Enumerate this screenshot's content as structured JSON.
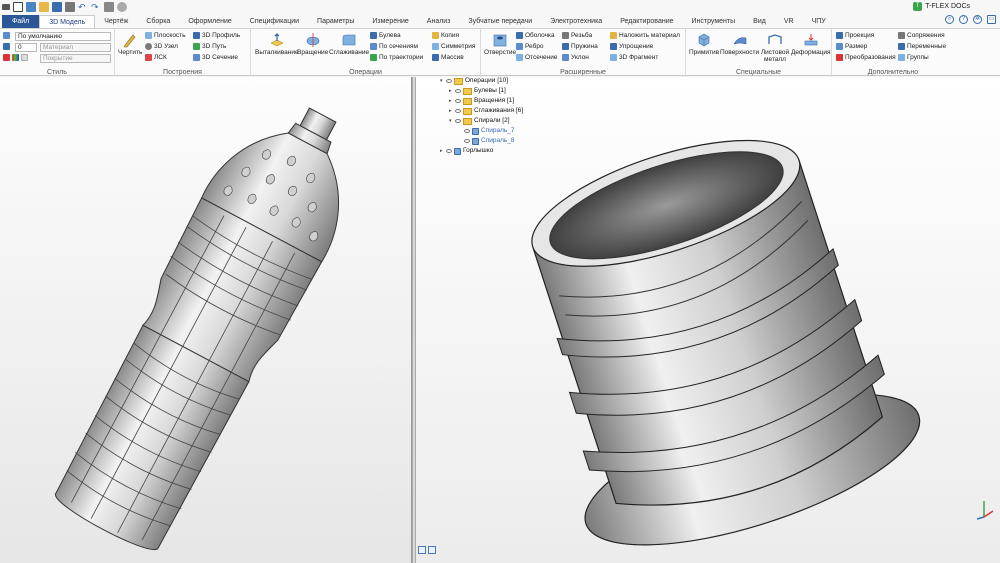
{
  "app": {
    "name": "T-FLEX DOCs"
  },
  "menu": {
    "tabs": [
      "Файл",
      "3D Модель",
      "Чертёж",
      "Сборка",
      "Оформление",
      "Спецификации",
      "Параметры",
      "Измерение",
      "Анализ",
      "Зубчатые передачи",
      "Электротехника",
      "Редактирование",
      "Инструменты",
      "Вид",
      "VR",
      "ЧПУ"
    ],
    "active_index": 1
  },
  "ribbon": {
    "style": {
      "title": "Стиль",
      "preset_value": "По умолчанию",
      "layer_value": "0",
      "material_placeholder": "Материал",
      "coating_placeholder": "Покрытие"
    },
    "build": {
      "title": "Построения",
      "draw_label": "Чертить",
      "plane_label": "Плоскость",
      "node3d_label": "3D Узел",
      "lsk_label": "ЛСК",
      "profile_label": "3D Профиль",
      "path_label": "3D Путь",
      "section_label": "3D Сечение"
    },
    "operations": {
      "title": "Операции",
      "extrude_label": "Выталкивание",
      "revolve_label": "Вращение",
      "smooth_label": "Сглаживание",
      "boolean_label": "Булева",
      "sections_label": "По сечениям",
      "trajectory_label": "По траектории",
      "copy_label": "Копия",
      "symmetry_label": "Симметрия",
      "array_label": "Массив"
    },
    "advanced": {
      "title": "Расширенные",
      "hole_label": "Отверстие",
      "shell_label": "Оболочка",
      "rib_label": "Ребро",
      "cut_label": "Отсечение",
      "thread_label": "Резьба",
      "spring_label": "Пружина",
      "slope_label": "Уклон",
      "apply_material_label": "Наложить материал",
      "simplify_label": "Упрощение",
      "fragment_label": "3D Фрагмент"
    },
    "special": {
      "title": "Специальные",
      "primitives_label": "Примитив",
      "surfaces_label": "Поверхности",
      "sheet_label": "Листовой металл",
      "deform_label": "Деформация"
    },
    "extra": {
      "title": "Дополнительно",
      "projection_label": "Проекция",
      "size_label": "Размер",
      "transform_label": "Преобразования",
      "mates_label": "Сопряжения",
      "variables_label": "Переменные",
      "groups_label": "Группы"
    }
  },
  "tree": {
    "items": [
      {
        "label": "Операции [10]",
        "level": 0,
        "kind": "folder",
        "expanded": true
      },
      {
        "label": "Булевы [1]",
        "level": 1,
        "kind": "folder",
        "expanded": false
      },
      {
        "label": "Вращения [1]",
        "level": 1,
        "kind": "folder",
        "expanded": false
      },
      {
        "label": "Сглаживания [6]",
        "level": 1,
        "kind": "folder",
        "expanded": false
      },
      {
        "label": "Спирали [2]",
        "level": 1,
        "kind": "folder",
        "expanded": true
      },
      {
        "label": "Спираль_7",
        "level": 2,
        "kind": "shape",
        "selected": true
      },
      {
        "label": "Спираль_8",
        "level": 2,
        "kind": "shape",
        "selected": true
      },
      {
        "label": "Горлышко",
        "level": 0,
        "kind": "shape",
        "expanded": false
      }
    ]
  },
  "colors": {
    "file_tab": "#2b5797",
    "accent": "#3a6cb0",
    "folder": "#f2c94c",
    "viewport_top": "#ffffff",
    "viewport_bottom": "#ececec"
  }
}
